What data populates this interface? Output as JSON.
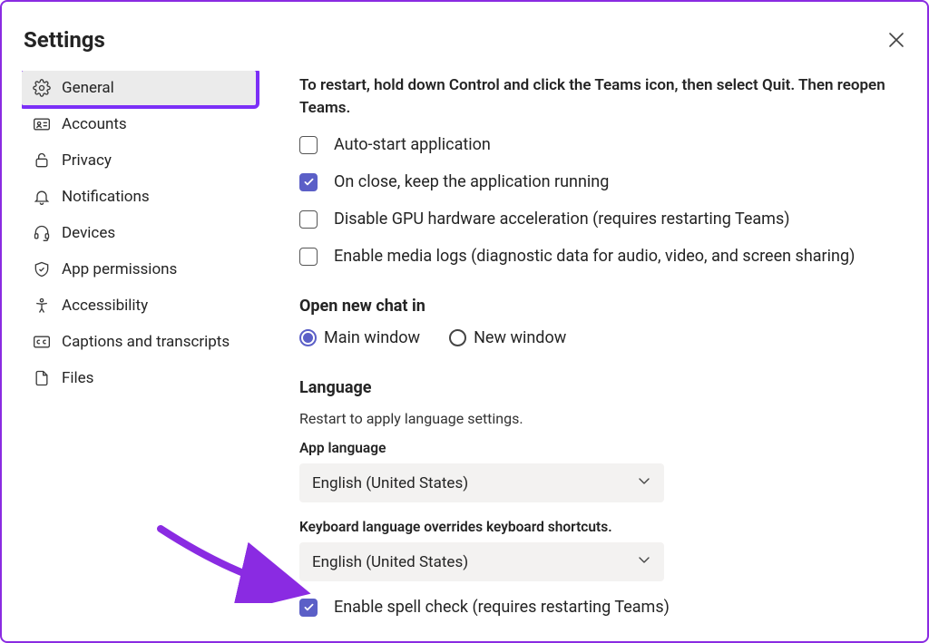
{
  "title": "Settings",
  "sidebar": {
    "items": [
      {
        "label": "General",
        "icon": "gear"
      },
      {
        "label": "Accounts",
        "icon": "id-card"
      },
      {
        "label": "Privacy",
        "icon": "lock"
      },
      {
        "label": "Notifications",
        "icon": "bell"
      },
      {
        "label": "Devices",
        "icon": "headset"
      },
      {
        "label": "App permissions",
        "icon": "shield"
      },
      {
        "label": "Accessibility",
        "icon": "person"
      },
      {
        "label": "Captions and transcripts",
        "icon": "cc"
      },
      {
        "label": "Files",
        "icon": "file"
      }
    ]
  },
  "main": {
    "restart_note": "To restart, hold down Control and click the Teams icon, then select Quit. Then reopen Teams.",
    "checks": [
      {
        "label": "Auto-start application",
        "checked": false
      },
      {
        "label": "On close, keep the application running",
        "checked": true
      },
      {
        "label": "Disable GPU hardware acceleration (requires restarting Teams)",
        "checked": false
      },
      {
        "label": "Enable media logs (diagnostic data for audio, video, and screen sharing)",
        "checked": false
      }
    ],
    "openchat": {
      "heading": "Open new chat in",
      "options": [
        {
          "label": "Main window",
          "selected": true
        },
        {
          "label": "New window",
          "selected": false
        }
      ]
    },
    "language": {
      "heading": "Language",
      "subtitle": "Restart to apply language settings.",
      "app_label": "App language",
      "app_value": "English (United States)",
      "kb_label": "Keyboard language overrides keyboard shortcuts.",
      "kb_value": "English (United States)",
      "spellcheck": {
        "label": "Enable spell check (requires restarting Teams)",
        "checked": true
      }
    }
  }
}
